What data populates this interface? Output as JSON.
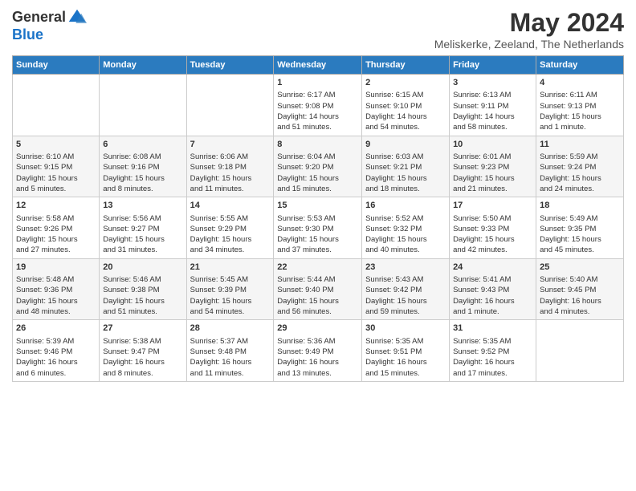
{
  "header": {
    "logo_general": "General",
    "logo_blue": "Blue",
    "main_title": "May 2024",
    "subtitle": "Meliskerke, Zeeland, The Netherlands"
  },
  "days_of_week": [
    "Sunday",
    "Monday",
    "Tuesday",
    "Wednesday",
    "Thursday",
    "Friday",
    "Saturday"
  ],
  "weeks": [
    [
      {
        "day": "",
        "info": ""
      },
      {
        "day": "",
        "info": ""
      },
      {
        "day": "",
        "info": ""
      },
      {
        "day": "1",
        "info": "Sunrise: 6:17 AM\nSunset: 9:08 PM\nDaylight: 14 hours\nand 51 minutes."
      },
      {
        "day": "2",
        "info": "Sunrise: 6:15 AM\nSunset: 9:10 PM\nDaylight: 14 hours\nand 54 minutes."
      },
      {
        "day": "3",
        "info": "Sunrise: 6:13 AM\nSunset: 9:11 PM\nDaylight: 14 hours\nand 58 minutes."
      },
      {
        "day": "4",
        "info": "Sunrise: 6:11 AM\nSunset: 9:13 PM\nDaylight: 15 hours\nand 1 minute."
      }
    ],
    [
      {
        "day": "5",
        "info": "Sunrise: 6:10 AM\nSunset: 9:15 PM\nDaylight: 15 hours\nand 5 minutes."
      },
      {
        "day": "6",
        "info": "Sunrise: 6:08 AM\nSunset: 9:16 PM\nDaylight: 15 hours\nand 8 minutes."
      },
      {
        "day": "7",
        "info": "Sunrise: 6:06 AM\nSunset: 9:18 PM\nDaylight: 15 hours\nand 11 minutes."
      },
      {
        "day": "8",
        "info": "Sunrise: 6:04 AM\nSunset: 9:20 PM\nDaylight: 15 hours\nand 15 minutes."
      },
      {
        "day": "9",
        "info": "Sunrise: 6:03 AM\nSunset: 9:21 PM\nDaylight: 15 hours\nand 18 minutes."
      },
      {
        "day": "10",
        "info": "Sunrise: 6:01 AM\nSunset: 9:23 PM\nDaylight: 15 hours\nand 21 minutes."
      },
      {
        "day": "11",
        "info": "Sunrise: 5:59 AM\nSunset: 9:24 PM\nDaylight: 15 hours\nand 24 minutes."
      }
    ],
    [
      {
        "day": "12",
        "info": "Sunrise: 5:58 AM\nSunset: 9:26 PM\nDaylight: 15 hours\nand 27 minutes."
      },
      {
        "day": "13",
        "info": "Sunrise: 5:56 AM\nSunset: 9:27 PM\nDaylight: 15 hours\nand 31 minutes."
      },
      {
        "day": "14",
        "info": "Sunrise: 5:55 AM\nSunset: 9:29 PM\nDaylight: 15 hours\nand 34 minutes."
      },
      {
        "day": "15",
        "info": "Sunrise: 5:53 AM\nSunset: 9:30 PM\nDaylight: 15 hours\nand 37 minutes."
      },
      {
        "day": "16",
        "info": "Sunrise: 5:52 AM\nSunset: 9:32 PM\nDaylight: 15 hours\nand 40 minutes."
      },
      {
        "day": "17",
        "info": "Sunrise: 5:50 AM\nSunset: 9:33 PM\nDaylight: 15 hours\nand 42 minutes."
      },
      {
        "day": "18",
        "info": "Sunrise: 5:49 AM\nSunset: 9:35 PM\nDaylight: 15 hours\nand 45 minutes."
      }
    ],
    [
      {
        "day": "19",
        "info": "Sunrise: 5:48 AM\nSunset: 9:36 PM\nDaylight: 15 hours\nand 48 minutes."
      },
      {
        "day": "20",
        "info": "Sunrise: 5:46 AM\nSunset: 9:38 PM\nDaylight: 15 hours\nand 51 minutes."
      },
      {
        "day": "21",
        "info": "Sunrise: 5:45 AM\nSunset: 9:39 PM\nDaylight: 15 hours\nand 54 minutes."
      },
      {
        "day": "22",
        "info": "Sunrise: 5:44 AM\nSunset: 9:40 PM\nDaylight: 15 hours\nand 56 minutes."
      },
      {
        "day": "23",
        "info": "Sunrise: 5:43 AM\nSunset: 9:42 PM\nDaylight: 15 hours\nand 59 minutes."
      },
      {
        "day": "24",
        "info": "Sunrise: 5:41 AM\nSunset: 9:43 PM\nDaylight: 16 hours\nand 1 minute."
      },
      {
        "day": "25",
        "info": "Sunrise: 5:40 AM\nSunset: 9:45 PM\nDaylight: 16 hours\nand 4 minutes."
      }
    ],
    [
      {
        "day": "26",
        "info": "Sunrise: 5:39 AM\nSunset: 9:46 PM\nDaylight: 16 hours\nand 6 minutes."
      },
      {
        "day": "27",
        "info": "Sunrise: 5:38 AM\nSunset: 9:47 PM\nDaylight: 16 hours\nand 8 minutes."
      },
      {
        "day": "28",
        "info": "Sunrise: 5:37 AM\nSunset: 9:48 PM\nDaylight: 16 hours\nand 11 minutes."
      },
      {
        "day": "29",
        "info": "Sunrise: 5:36 AM\nSunset: 9:49 PM\nDaylight: 16 hours\nand 13 minutes."
      },
      {
        "day": "30",
        "info": "Sunrise: 5:35 AM\nSunset: 9:51 PM\nDaylight: 16 hours\nand 15 minutes."
      },
      {
        "day": "31",
        "info": "Sunrise: 5:35 AM\nSunset: 9:52 PM\nDaylight: 16 hours\nand 17 minutes."
      },
      {
        "day": "",
        "info": ""
      }
    ]
  ]
}
